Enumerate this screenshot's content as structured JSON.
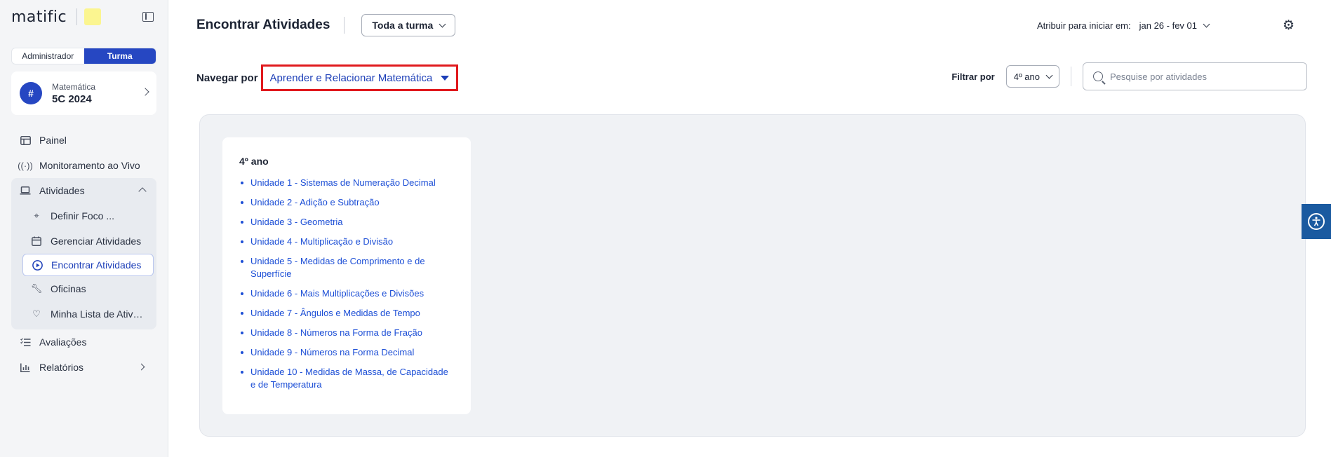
{
  "brand": {
    "logo_text": "matific"
  },
  "sidebar": {
    "role_tabs": [
      "Administrador",
      "Turma"
    ],
    "class_card": {
      "subject": "Matemática",
      "name": "5C 2024",
      "avatar_glyph": "#"
    },
    "items": [
      {
        "label": "Painel",
        "icon": "layout-icon"
      },
      {
        "label": "Monitoramento ao Vivo",
        "icon": "broadcast-icon"
      },
      {
        "label": "Atividades",
        "icon": "laptop-icon"
      },
      {
        "label": "Avaliações",
        "icon": "checklist-icon"
      },
      {
        "label": "Relatórios",
        "icon": "bar-chart-icon"
      }
    ],
    "sub_items": [
      {
        "label": "Definir Foco ...",
        "icon": "crosshair-icon"
      },
      {
        "label": "Gerenciar Atividades",
        "icon": "calendar-icon"
      },
      {
        "label": "Encontrar Atividades",
        "icon": "play-circle-icon"
      },
      {
        "label": "Oficinas",
        "icon": "wrench-icon"
      },
      {
        "label": "Minha Lista de Atividades",
        "icon": "heart-icon"
      }
    ]
  },
  "header": {
    "title": "Encontrar Atividades",
    "scope": "Toda a turma",
    "assign_label": "Atribuir para iniciar em:",
    "assign_range": "jan 26 - fev 01"
  },
  "browse": {
    "label": "Navegar por",
    "value": "Aprender e Relacionar Matemática"
  },
  "filter": {
    "label": "Filtrar por",
    "grade": "4º ano",
    "search_placeholder": "Pesquise por atividades"
  },
  "grade_card": {
    "title": "4º ano",
    "units": [
      "Unidade 1 - Sistemas de Numeração Decimal",
      "Unidade 2 - Adição e Subtração",
      "Unidade 3 - Geometria",
      "Unidade 4 - Multiplicação e Divisão",
      "Unidade 5 - Medidas de Comprimento e de Superfície",
      "Unidade 6 - Mais Multiplicações e Divisões",
      "Unidade 7 - Ângulos e Medidas de Tempo",
      "Unidade 8 - Números na Forma de Fração",
      "Unidade 9 - Números na Forma Decimal",
      "Unidade 10 - Medidas de Massa, de Capacidade e de Temperatura"
    ]
  },
  "colors": {
    "primary": "#2647c2",
    "link": "#1d4fd6",
    "highlight_border": "#e0191d",
    "a11y": "#1a5aa0"
  }
}
